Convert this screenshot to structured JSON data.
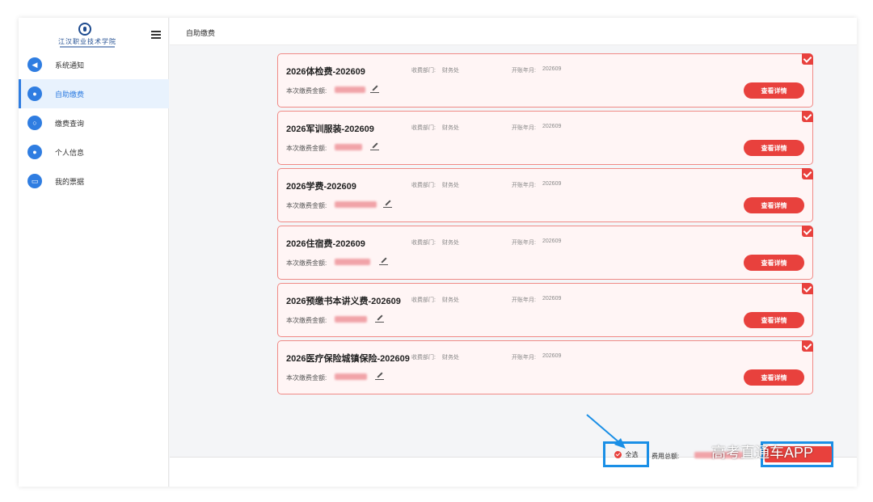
{
  "sidebar": {
    "logo_text": "江汉职业技术学院",
    "menu_icon": "hamburger-icon",
    "items": [
      {
        "label": "系统通知",
        "icon": "speaker-icon",
        "active": false
      },
      {
        "label": "自助缴费",
        "icon": "pay-icon",
        "active": true
      },
      {
        "label": "缴费查询",
        "icon": "search-icon",
        "active": false
      },
      {
        "label": "个人信息",
        "icon": "user-icon",
        "active": false
      },
      {
        "label": "我的票据",
        "icon": "receipt-icon",
        "active": false
      }
    ]
  },
  "header": {
    "title": "自助缴费"
  },
  "fee_labels": {
    "dept_label": "收费部门:",
    "year_label": "开账年月:",
    "amount_label": "本次缴费金额:",
    "detail_button": "查看详情"
  },
  "fees": [
    {
      "title": "2026体检费-202609",
      "dept": "财务处",
      "year_month": "202609",
      "checked": true
    },
    {
      "title": "2026军训服装-202609",
      "dept": "财务处",
      "year_month": "202609",
      "checked": true
    },
    {
      "title": "2026学费-202609",
      "dept": "财务处",
      "year_month": "202609",
      "checked": true
    },
    {
      "title": "2026住宿费-202609",
      "dept": "财务处",
      "year_month": "202609",
      "checked": true
    },
    {
      "title": "2026预缴书本讲义费-202609",
      "dept": "财务处",
      "year_month": "202609",
      "checked": true
    },
    {
      "title": "2026医疗保险城镇保险-202609",
      "dept": "财务处",
      "year_month": "202609",
      "checked": true
    }
  ],
  "footer": {
    "select_all_label": "全选",
    "total_label": "费用总额:"
  },
  "watermark": "高考直通车APP",
  "colors": {
    "accent": "#2f7de1",
    "danger": "#e8413d",
    "card_bg": "#fff5f5",
    "card_border": "#f08a86",
    "highlight": "#1a8fe6"
  }
}
